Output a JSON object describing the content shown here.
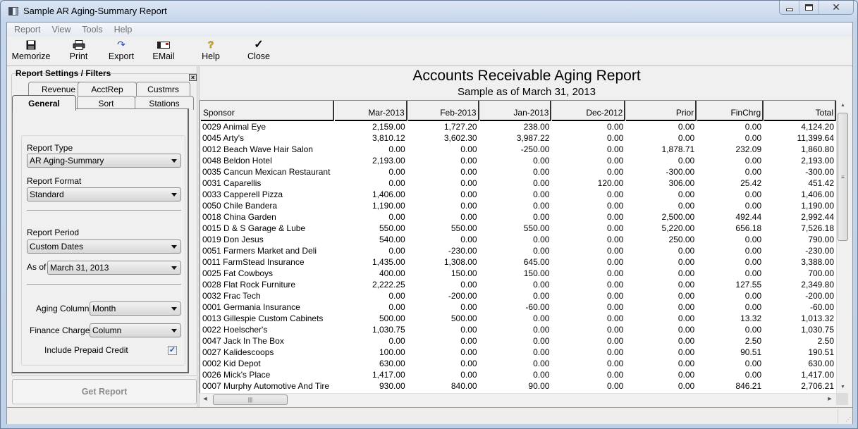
{
  "window": {
    "title": "Sample AR Aging-Summary Report"
  },
  "menu": [
    "Report",
    "View",
    "Tools",
    "Help"
  ],
  "toolbar": [
    {
      "label": "Memorize",
      "icon": "save-icon"
    },
    {
      "label": "Print",
      "icon": "printer-icon"
    },
    {
      "label": "Export",
      "icon": "export-icon"
    },
    {
      "label": "EMail",
      "icon": "email-icon"
    },
    {
      "label": "Help",
      "icon": "help-icon"
    },
    {
      "label": "Close",
      "icon": "checkmark-icon"
    }
  ],
  "settings": {
    "title": "Report Settings / Filters",
    "tabs_back": [
      "Revenue",
      "AcctRep",
      "Custmrs"
    ],
    "tabs_front": [
      "General",
      "Sort",
      "Stations"
    ],
    "active_tab": "General",
    "report_type_label": "Report Type",
    "report_type_value": "AR Aging-Summary",
    "report_format_label": "Report Format",
    "report_format_value": "Standard",
    "report_period_label": "Report Period",
    "report_period_value": "Custom Dates",
    "as_of_label": "As of",
    "as_of_value": "March 31, 2013",
    "aging_columns_label": "Aging Columns",
    "aging_columns_value": "Month",
    "finance_charges_label": "Finance Charges",
    "finance_charges_value": "Column",
    "include_prepaid_label": "Include Prepaid Credit",
    "include_prepaid_checked": true,
    "checkmark": "✓",
    "get_report_label": "Get Report"
  },
  "report": {
    "title": "Accounts Receivable Aging Report",
    "subtitle": "Sample  as of March 31, 2013",
    "columns": [
      "Sponsor",
      "Mar-2013",
      "Feb-2013",
      "Jan-2013",
      "Dec-2012",
      "Prior",
      "FinChrg",
      "Total"
    ],
    "rows": [
      [
        "0029 Animal Eye",
        "2,159.00",
        "1,727.20",
        "238.00",
        "0.00",
        "0.00",
        "0.00",
        "4,124.20"
      ],
      [
        "0045 Arty's",
        "3,810.12",
        "3,602.30",
        "3,987.22",
        "0.00",
        "0.00",
        "0.00",
        "11,399.64"
      ],
      [
        "0012 Beach Wave Hair Salon",
        "0.00",
        "0.00",
        "-250.00",
        "0.00",
        "1,878.71",
        "232.09",
        "1,860.80"
      ],
      [
        "0048 Beldon Hotel",
        "2,193.00",
        "0.00",
        "0.00",
        "0.00",
        "0.00",
        "0.00",
        "2,193.00"
      ],
      [
        "0035 Cancun Mexican Restaurant",
        "0.00",
        "0.00",
        "0.00",
        "0.00",
        "-300.00",
        "0.00",
        "-300.00"
      ],
      [
        "0031 Caparellis",
        "0.00",
        "0.00",
        "0.00",
        "120.00",
        "306.00",
        "25.42",
        "451.42"
      ],
      [
        "0033 Capperell Pizza",
        "1,406.00",
        "0.00",
        "0.00",
        "0.00",
        "0.00",
        "0.00",
        "1,406.00"
      ],
      [
        "0050 Chile Bandera",
        "1,190.00",
        "0.00",
        "0.00",
        "0.00",
        "0.00",
        "0.00",
        "1,190.00"
      ],
      [
        "0018 China Garden",
        "0.00",
        "0.00",
        "0.00",
        "0.00",
        "2,500.00",
        "492.44",
        "2,992.44"
      ],
      [
        "0015 D & S Garage & Lube",
        "550.00",
        "550.00",
        "550.00",
        "0.00",
        "5,220.00",
        "656.18",
        "7,526.18"
      ],
      [
        "0019 Don Jesus",
        "540.00",
        "0.00",
        "0.00",
        "0.00",
        "250.00",
        "0.00",
        "790.00"
      ],
      [
        "0051 Farmers Market and Deli",
        "0.00",
        "-230.00",
        "0.00",
        "0.00",
        "0.00",
        "0.00",
        "-230.00"
      ],
      [
        "0011 FarmStead Insurance",
        "1,435.00",
        "1,308.00",
        "645.00",
        "0.00",
        "0.00",
        "0.00",
        "3,388.00"
      ],
      [
        "0025 Fat Cowboys",
        "400.00",
        "150.00",
        "150.00",
        "0.00",
        "0.00",
        "0.00",
        "700.00"
      ],
      [
        "0028 Flat Rock Furniture",
        "2,222.25",
        "0.00",
        "0.00",
        "0.00",
        "0.00",
        "127.55",
        "2,349.80"
      ],
      [
        "0032 Frac Tech",
        "0.00",
        "-200.00",
        "0.00",
        "0.00",
        "0.00",
        "0.00",
        "-200.00"
      ],
      [
        "0001 Germania Insurance",
        "0.00",
        "0.00",
        "-60.00",
        "0.00",
        "0.00",
        "0.00",
        "-60.00"
      ],
      [
        "0013 Gillespie Custom Cabinets",
        "500.00",
        "500.00",
        "0.00",
        "0.00",
        "0.00",
        "13.32",
        "1,013.32"
      ],
      [
        "0022 Hoelscher's",
        "1,030.75",
        "0.00",
        "0.00",
        "0.00",
        "0.00",
        "0.00",
        "1,030.75"
      ],
      [
        "0047 Jack In The Box",
        "0.00",
        "0.00",
        "0.00",
        "0.00",
        "0.00",
        "2.50",
        "2.50"
      ],
      [
        "0027 Kalidescoops",
        "100.00",
        "0.00",
        "0.00",
        "0.00",
        "0.00",
        "90.51",
        "190.51"
      ],
      [
        "0002 Kid Depot",
        "630.00",
        "0.00",
        "0.00",
        "0.00",
        "0.00",
        "0.00",
        "630.00"
      ],
      [
        "0026 Mick's Place",
        "1,417.00",
        "0.00",
        "0.00",
        "0.00",
        "0.00",
        "0.00",
        "1,417.00"
      ],
      [
        "0007 Murphy Automotive And Tire",
        "930.00",
        "840.00",
        "90.00",
        "0.00",
        "0.00",
        "846.21",
        "2,706.21"
      ]
    ]
  }
}
